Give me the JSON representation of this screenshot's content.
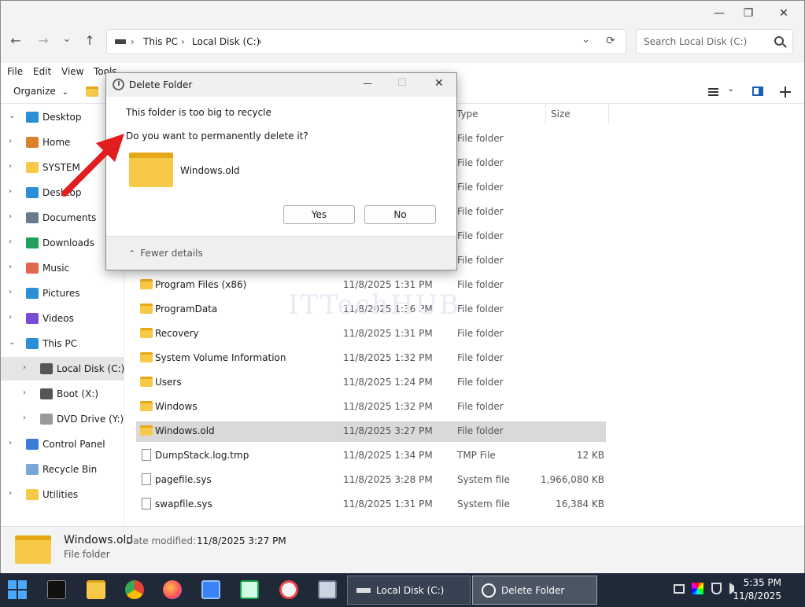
{
  "window": {
    "controls": {
      "minimize": "—",
      "maximize": "❐",
      "close": "✕"
    },
    "nav": {
      "back": "←",
      "forward": "→",
      "recent": "⌄",
      "up": "↑"
    },
    "address": {
      "crumbs": [
        "This PC",
        "Local Disk (C:)"
      ],
      "separator": "›",
      "dropdown": "⌄",
      "refresh": "⟳"
    },
    "search": {
      "placeholder": "Search Local Disk (C:)"
    },
    "menubar": [
      "File",
      "Edit",
      "View",
      "Tools"
    ],
    "cmdbar": {
      "organize": "Organize",
      "view_more": "⌄"
    }
  },
  "nav_pane": {
    "items": [
      {
        "label": "Desktop",
        "chev": "⌄",
        "icon": "desktop-icon",
        "color": "#2b8fd6"
      },
      {
        "label": "Home",
        "chev": "›",
        "icon": "home-icon",
        "color": "#d9822b"
      },
      {
        "label": "SYSTEM",
        "chev": "›",
        "icon": "folder-icon",
        "color": "#f7c948"
      },
      {
        "label": "Desktop",
        "chev": "›",
        "icon": "desktop-icon",
        "color": "#2b8fd6"
      },
      {
        "label": "Documents",
        "chev": "›",
        "icon": "documents-icon",
        "color": "#6b7a90"
      },
      {
        "label": "Downloads",
        "chev": "›",
        "icon": "downloads-icon",
        "color": "#20a05a"
      },
      {
        "label": "Music",
        "chev": "›",
        "icon": "music-icon",
        "color": "#e0674b"
      },
      {
        "label": "Pictures",
        "chev": "›",
        "icon": "pictures-icon",
        "color": "#2b8fd6"
      },
      {
        "label": "Videos",
        "chev": "›",
        "icon": "videos-icon",
        "color": "#7a4bd6"
      },
      {
        "label": "This PC",
        "chev": "⌄",
        "icon": "pc-icon",
        "color": "#2b8fd6"
      },
      {
        "label": "Local Disk (C:)",
        "chev": "›",
        "icon": "drive-icon",
        "color": "#555555",
        "selected": true
      },
      {
        "label": "Boot (X:)",
        "chev": "›",
        "icon": "drive-icon",
        "color": "#555555"
      },
      {
        "label": "DVD Drive (Y:) H",
        "chev": "›",
        "icon": "dvd-icon",
        "color": "#9a9a9a"
      },
      {
        "label": "Control Panel",
        "chev": "›",
        "icon": "control-panel-icon",
        "color": "#3a7bd5"
      },
      {
        "label": "Recycle Bin",
        "chev": "",
        "icon": "recycle-bin-icon",
        "color": "#7aa6d8"
      },
      {
        "label": "Utilities",
        "chev": "›",
        "icon": "folder-icon",
        "color": "#f7c948"
      }
    ]
  },
  "file_list": {
    "headers": {
      "type": "Type",
      "size": "Size"
    },
    "rows": [
      {
        "name": "",
        "date": "",
        "type": "File folder",
        "size": ""
      },
      {
        "name": "",
        "date": "",
        "type": "File folder",
        "size": ""
      },
      {
        "name": "",
        "date": "",
        "type": "File folder",
        "size": ""
      },
      {
        "name": "",
        "date": "",
        "type": "File folder",
        "size": ""
      },
      {
        "name": "",
        "date": "",
        "type": "File folder",
        "size": ""
      },
      {
        "name": "",
        "date": "",
        "type": "File folder",
        "size": ""
      },
      {
        "name": "Program Files (x86)",
        "date": "11/8/2025 1:31 PM",
        "type": "File folder",
        "size": "",
        "kind": "folder"
      },
      {
        "name": "ProgramData",
        "date": "11/8/2025 1:36 PM",
        "type": "File folder",
        "size": "",
        "kind": "folder"
      },
      {
        "name": "Recovery",
        "date": "11/8/2025 1:31 PM",
        "type": "File folder",
        "size": "",
        "kind": "folder"
      },
      {
        "name": "System Volume Information",
        "date": "11/8/2025 1:32 PM",
        "type": "File folder",
        "size": "",
        "kind": "folder"
      },
      {
        "name": "Users",
        "date": "11/8/2025 1:24 PM",
        "type": "File folder",
        "size": "",
        "kind": "folder"
      },
      {
        "name": "Windows",
        "date": "11/8/2025 1:32 PM",
        "type": "File folder",
        "size": "",
        "kind": "folder"
      },
      {
        "name": "Windows.old",
        "date": "11/8/2025 3:27 PM",
        "type": "File folder",
        "size": "",
        "kind": "folder",
        "selected": true
      },
      {
        "name": "DumpStack.log.tmp",
        "date": "11/8/2025 1:34 PM",
        "type": "TMP File",
        "size": "12 KB",
        "kind": "file"
      },
      {
        "name": "pagefile.sys",
        "date": "11/8/2025 3:28 PM",
        "type": "System file",
        "size": "1,966,080 KB",
        "kind": "file"
      },
      {
        "name": "swapfile.sys",
        "date": "11/8/2025 1:31 PM",
        "type": "System file",
        "size": "16,384 KB",
        "kind": "file"
      }
    ]
  },
  "watermark": "ITTechHUB",
  "details": {
    "name": "Windows.old",
    "date_label": "Date modified:",
    "date_value": "11/8/2025 3:27 PM",
    "type": "File folder"
  },
  "dialog": {
    "title": "Delete Folder",
    "message": "This folder is too big to recycle",
    "question": "Do you want to permanently delete it?",
    "item_name": "Windows.old",
    "yes": "Yes",
    "no": "No",
    "fewer_details": "Fewer details",
    "controls": {
      "minimize": "—",
      "maximize": "☐",
      "close": "✕"
    }
  },
  "taskbar": {
    "tasks": [
      {
        "label": "Local Disk (C:)",
        "icon": "drive-icon"
      },
      {
        "label": "Delete Folder",
        "icon": "clock-icon",
        "active": true
      }
    ],
    "clock": {
      "time": "5:35 PM",
      "date": "11/8/2025"
    }
  },
  "colors": {
    "selection": "#d9d9d9",
    "folder": "#f7c948",
    "taskbar": "#1f2937",
    "arrow": "#e11d1d"
  }
}
